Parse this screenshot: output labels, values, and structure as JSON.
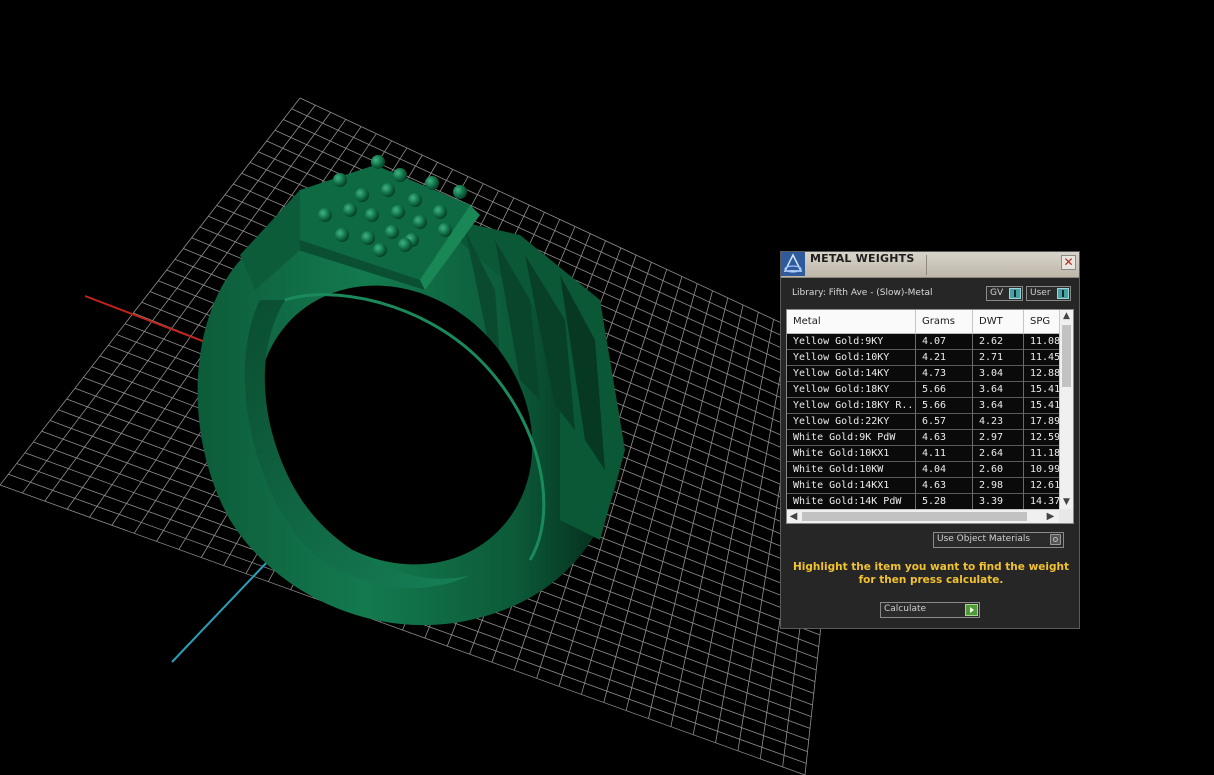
{
  "panel": {
    "title": "METAL WEIGHTS",
    "close_glyph": "✕",
    "library_label": "Library: Fifth Ave - (Slow)-Metal",
    "toggle_gv": "GV",
    "toggle_user": "User",
    "use_object_materials": "Use Object Materials",
    "hint": "Highlight the item you want to find the weight for then press calculate.",
    "calculate_label": "Calculate"
  },
  "table": {
    "columns": [
      "Metal",
      "Grams",
      "DWT",
      "SPG"
    ],
    "rows": [
      [
        "Yellow Gold:9KY",
        "4.07",
        "2.62",
        "11.08"
      ],
      [
        "Yellow Gold:10KY",
        "4.21",
        "2.71",
        "11.45"
      ],
      [
        "Yellow Gold:14KY",
        "4.73",
        "3.04",
        "12.88"
      ],
      [
        "Yellow Gold:18KY",
        "5.66",
        "3.64",
        "15.41"
      ],
      [
        "Yellow Gold:18KY R...",
        "5.66",
        "3.64",
        "15.41"
      ],
      [
        "Yellow Gold:22KY",
        "6.57",
        "4.23",
        "17.89"
      ],
      [
        "White Gold:9K PdW",
        "4.63",
        "2.97",
        "12.59"
      ],
      [
        "White Gold:10KX1",
        "4.11",
        "2.64",
        "11.18"
      ],
      [
        "White Gold:10KW",
        "4.04",
        "2.60",
        "10.99"
      ],
      [
        "White Gold:14KX1",
        "4.63",
        "2.98",
        "12.61"
      ],
      [
        "White Gold:14K PdW",
        "5.28",
        "3.39",
        "14.37"
      ]
    ]
  },
  "icons": {
    "title": "app-logo-icon",
    "close": "close-icon",
    "scroll_up": "▲",
    "scroll_down": "▼",
    "scroll_left": "◀",
    "scroll_right": "▶"
  },
  "colors": {
    "viewport_bg": "#000000",
    "grid": "#9a9a9a",
    "ring": "#0f6e45",
    "hint": "#f1c232",
    "axis_x": "#c0231c",
    "axis_y": "#2aa0b8"
  }
}
